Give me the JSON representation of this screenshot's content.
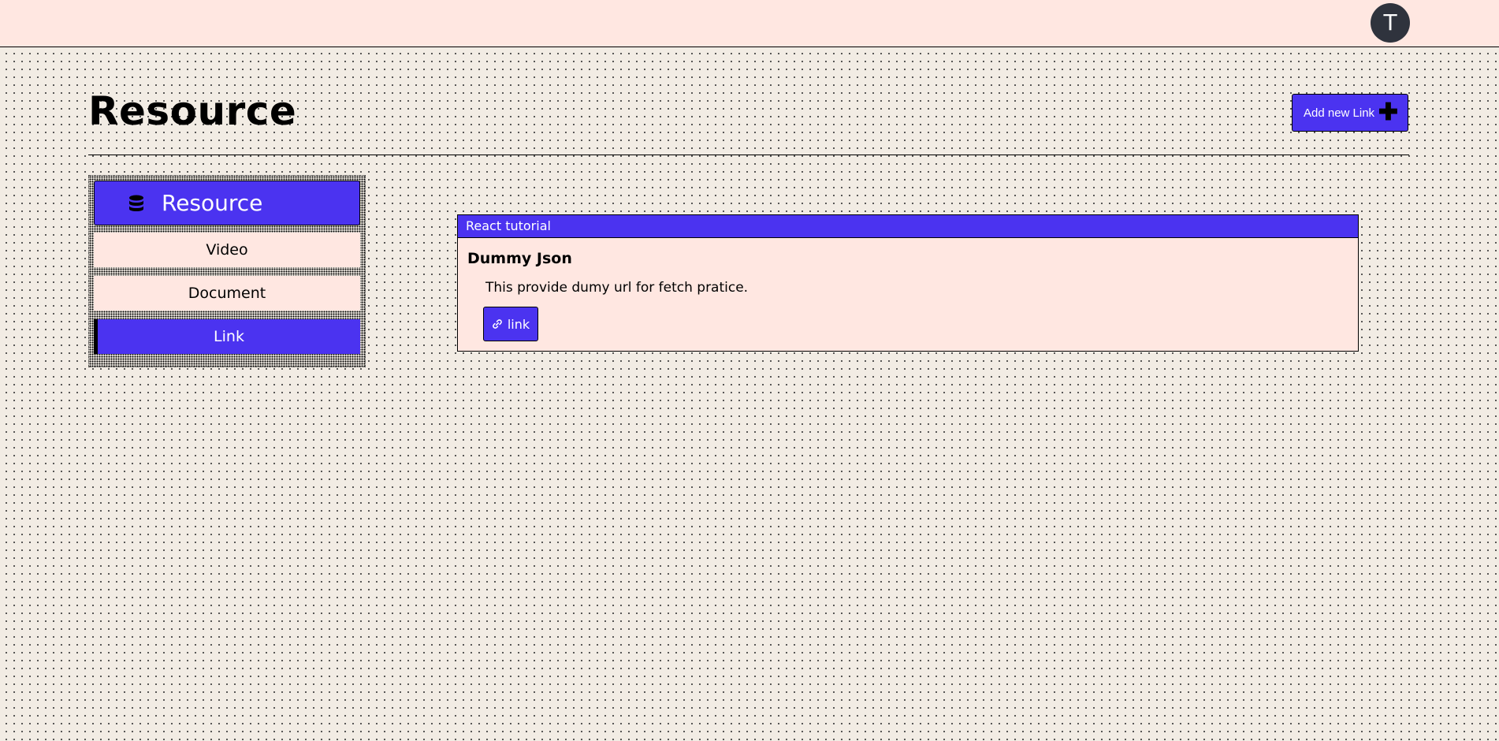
{
  "topbar": {
    "avatar_initial": "T"
  },
  "page": {
    "title": "Resource",
    "add_button_label": "Add new Link",
    "add_button_icon": "plus-icon"
  },
  "sidebar": {
    "header_icon": "database-icon",
    "header_label": "Resource",
    "items": [
      {
        "label": "Video",
        "active": false
      },
      {
        "label": "Document",
        "active": false
      },
      {
        "label": "Link",
        "active": true
      }
    ]
  },
  "cards": [
    {
      "category": "React tutorial",
      "title": "Dummy Json",
      "description": "This provide dumy url for fetch pratice.",
      "link_label": "link",
      "link_icon": "link-icon"
    }
  ],
  "colors": {
    "accent": "#4b33f0",
    "panel": "#ffe7e1",
    "background": "#f2ece4",
    "avatar": "#2f333d"
  }
}
